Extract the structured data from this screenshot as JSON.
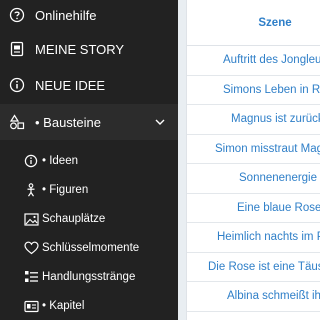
{
  "sidebar": {
    "items": [
      {
        "label": "Onlinehilfe",
        "icon": "help-circle-icon"
      },
      {
        "label": "MEINE STORY",
        "icon": "story-book-icon"
      },
      {
        "label": "NEUE IDEE",
        "icon": "info-circle-icon"
      },
      {
        "label": "• Bausteine",
        "icon": "shapes-icon",
        "expanded": true
      }
    ],
    "subitems": [
      {
        "label": "• Ideen",
        "icon": "info-circle-icon"
      },
      {
        "label": "• Figuren",
        "icon": "figure-icon"
      },
      {
        "label": "Schauplätze",
        "icon": "image-icon"
      },
      {
        "label": "Schlüsselmomente",
        "icon": "heart-icon"
      },
      {
        "label": "Handlungsstränge",
        "icon": "list-icon"
      },
      {
        "label": "• Kapitel",
        "icon": "id-card-icon"
      }
    ]
  },
  "table": {
    "header": "Szene",
    "rows": [
      "Auftritt des Jongleurs",
      "Simons Leben in Rom",
      "Magnus ist zurück",
      "Simon misstraut Magnus",
      "Sonnenenergie",
      "Eine blaue Rose",
      "Heimlich nachts im Park",
      "Die Rose ist eine Täuschung",
      "Albina schmeißt ihn raus"
    ]
  },
  "colors": {
    "sidebar_bg": "#222222",
    "active_bg": "#2c2c2c",
    "link": "#2f7fc8",
    "divider": "#e9eef2"
  }
}
